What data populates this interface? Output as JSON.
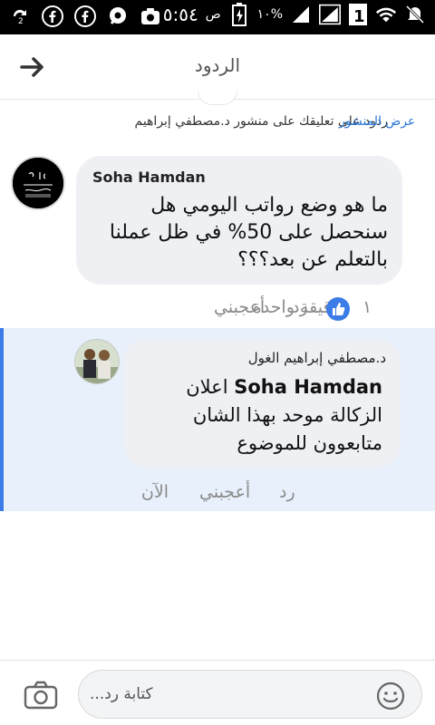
{
  "status_bar": {
    "time": "٥:٥٤",
    "ampm": "ص",
    "battery": "١٠%",
    "sim_badge": "1",
    "icons": [
      "sync-icon",
      "facebook-icon",
      "facebook-icon",
      "chat-icon",
      "camera-icon",
      "mute-icon",
      "wifi-icon",
      "sim-icon",
      "signal-icon",
      "signal-icon",
      "battery-icon"
    ]
  },
  "header": {
    "title": "الردود",
    "back_icon": "arrow-right-icon"
  },
  "context": {
    "reply_to": "ردود على تعليقك على منشور د.مصطفي إبراهيم",
    "view_post": "عرض المنشور"
  },
  "comment": {
    "author": "Soha Hamdan",
    "text": "ما هو وضع رواتب اليومي هل سنحصل على 50% في ظل عملنا بالتعلم عن بعد؟؟؟",
    "like_count": "١",
    "actions": {
      "reply": "رد",
      "like": "أعجبني",
      "time": "دقيقة واحدة"
    }
  },
  "reply": {
    "author": "د.مصطفي إبراهيم الغول",
    "mention": "Soha Hamdan",
    "text": "اعلان الزكالة موحد بهذا الشان متابعوون للموضوع",
    "actions": {
      "reply": "رد",
      "like": "أعجبني",
      "time": "الآن"
    }
  },
  "compose": {
    "placeholder": "كتابة رد...",
    "camera_icon": "camera-icon",
    "emoji_icon": "smiley-icon"
  }
}
